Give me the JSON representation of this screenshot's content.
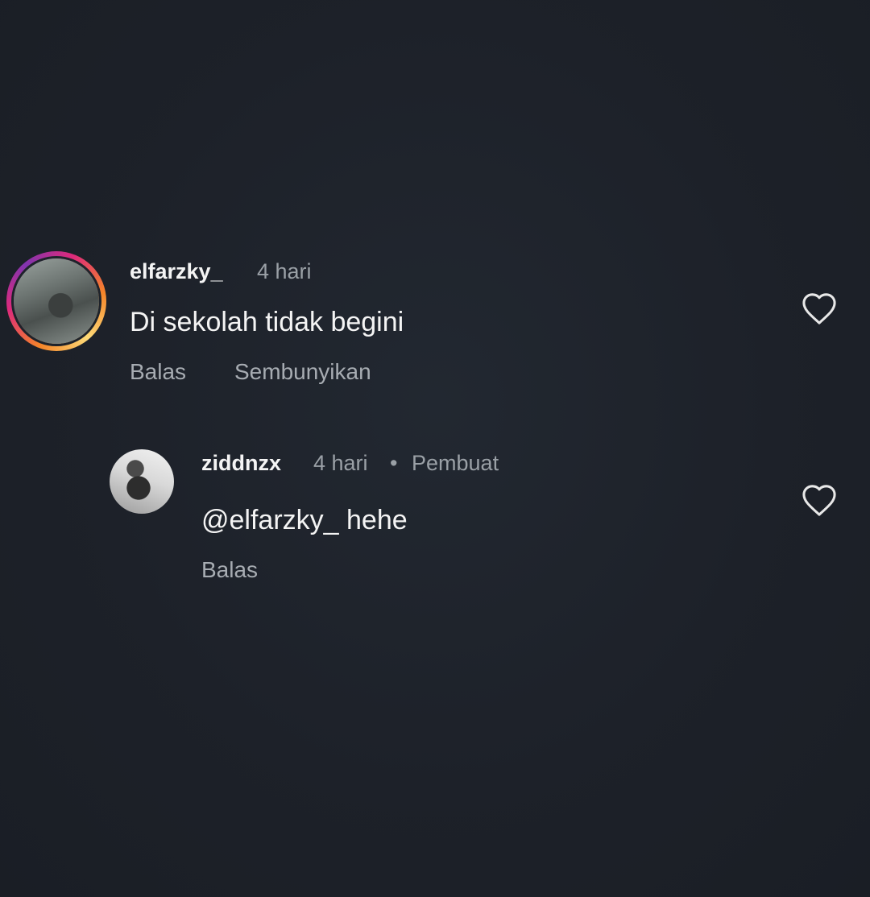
{
  "comments": [
    {
      "username": "elfarzky_",
      "time": "4 hari",
      "text": "Di sekolah tidak begini",
      "actions": [
        "Balas",
        "Sembunyikan"
      ]
    },
    {
      "username": "ziddnzx",
      "time": "4 hari",
      "separator": "•",
      "author_label": "Pembuat",
      "text": "@elfarzky_ hehe",
      "actions": [
        "Balas"
      ]
    }
  ],
  "icons": {
    "like": "heart-outline-icon",
    "story_ring_colors": [
      "#f58529",
      "#dd2a7b",
      "#8134af",
      "#feda77"
    ]
  },
  "colors": {
    "background": "#1e232b",
    "primary_text": "#f4f4f4",
    "secondary_text": "#9aa0a6"
  }
}
